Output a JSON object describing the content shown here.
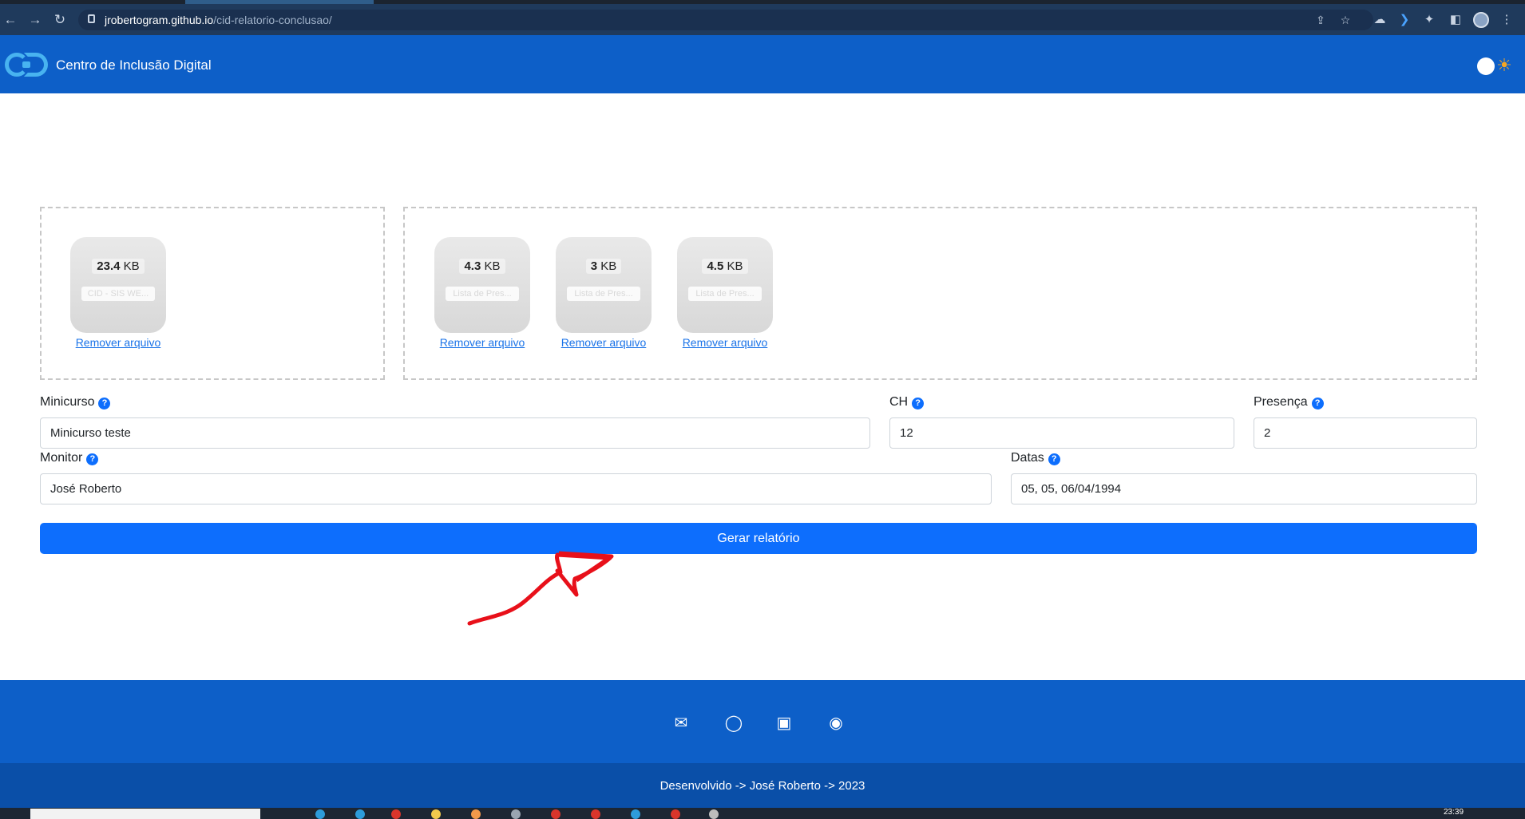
{
  "browser": {
    "url_host": "jrobertogram.github.io",
    "url_path": "/cid-relatorio-conclusao/"
  },
  "header": {
    "brand": "Centro de Inclusão Digital"
  },
  "uploads": {
    "left": [
      {
        "size_value": "23.4",
        "size_unit": "KB",
        "filename": "CID - SIS WE...",
        "remove_label": "Remover arquivo"
      }
    ],
    "right": [
      {
        "size_value": "4.3",
        "size_unit": "KB",
        "filename": "Lista de Pres...",
        "remove_label": "Remover arquivo"
      },
      {
        "size_value": "3",
        "size_unit": "KB",
        "filename": "Lista de Pres...",
        "remove_label": "Remover arquivo"
      },
      {
        "size_value": "4.5",
        "size_unit": "KB",
        "filename": "Lista de Pres...",
        "remove_label": "Remover arquivo"
      }
    ]
  },
  "form": {
    "minicurso": {
      "label": "Minicurso",
      "value": "Minicurso teste"
    },
    "ch": {
      "label": "CH",
      "value": "12"
    },
    "presenca": {
      "label": "Presença",
      "value": "2"
    },
    "monitor": {
      "label": "Monitor",
      "value": "José Roberto"
    },
    "datas": {
      "label": "Datas",
      "value": "05, 05, 06/04/1994"
    },
    "submit_label": "Gerar relatório"
  },
  "footer": {
    "social_icons": [
      "envelope-icon",
      "instagram-icon",
      "linkedin-icon",
      "github-icon"
    ],
    "credits": "Desenvolvido -> José Roberto -> 2023"
  },
  "taskbar": {
    "clock": "23:39"
  },
  "colors": {
    "header": "#0d5fc8",
    "primary_button": "#0d6efd",
    "annotation": "#e8101a"
  }
}
